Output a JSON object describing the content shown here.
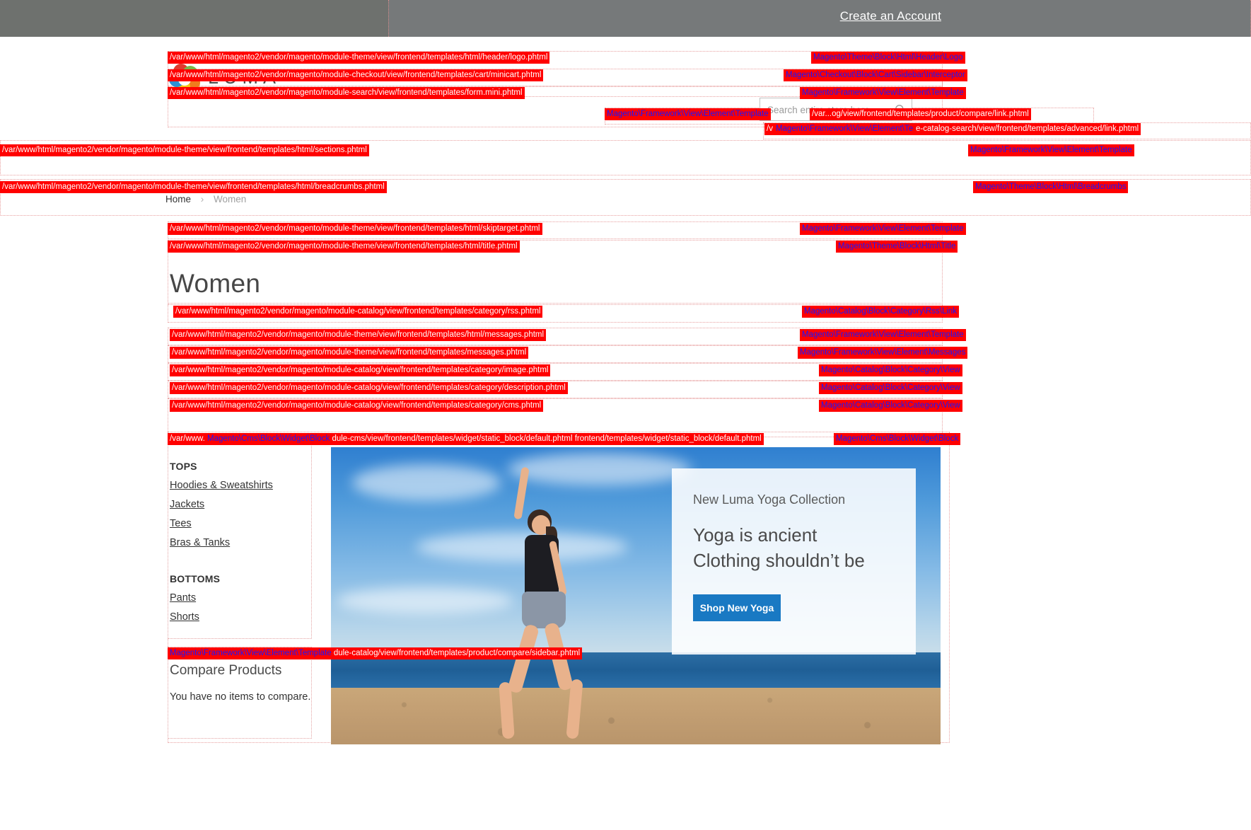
{
  "top_panel": {
    "create_account": "Create an Account"
  },
  "header": {
    "logo_text": "LUMA",
    "logo_alt": "luma-logo-icon"
  },
  "search": {
    "placeholder": "Search entire store here...",
    "value": ""
  },
  "breadcrumbs": {
    "home": "Home",
    "separator": "›",
    "current": "Women"
  },
  "page": {
    "title": "Women"
  },
  "sidebar": {
    "groups": [
      {
        "heading": "TOPS",
        "items": [
          "Hoodies & Sweatshirts",
          "Jackets",
          "Tees",
          "Bras & Tanks"
        ]
      },
      {
        "heading": "BOTTOMS",
        "items": [
          "Pants",
          "Shorts"
        ]
      }
    ]
  },
  "compare": {
    "title": "Compare Products",
    "empty_message": "You have no items to compare."
  },
  "promo": {
    "eyebrow": "New Luma Yoga Collection",
    "headline_line1": "Yoga is ancient",
    "headline_line2": "Clothing shouldn’t be",
    "button": "Shop New Yoga"
  },
  "colors": {
    "hint_background": "#ff0000",
    "hint_path_text": "#ffffff",
    "hint_class_text": "#1717ff",
    "top_panel": "#76797a",
    "button_primary": "#1979c3"
  },
  "hints": [
    {
      "id": "header-logo-path",
      "kind": "path",
      "text": "/var/www/html/magento2/vendor/magento/module-theme/view/frontend/templates/html/header/logo.phtml"
    },
    {
      "id": "header-logo-class",
      "kind": "class",
      "text": "Magento\\Theme\\Block\\Html\\Header\\Logo"
    },
    {
      "id": "minicart-path",
      "kind": "path",
      "text": "/var/www/html/magento2/vendor/magento/module-checkout/view/frontend/templates/cart/minicart.phtml"
    },
    {
      "id": "minicart-class",
      "kind": "class",
      "text": "Magento\\Checkout\\Block\\Cart\\Sidebar\\Interceptor"
    },
    {
      "id": "search-form-path",
      "kind": "path",
      "text": "/var/www/html/magento2/vendor/magento/module-search/view/frontend/templates/form.mini.phtml"
    },
    {
      "id": "search-form-class",
      "kind": "class",
      "text": "Magento\\Framework\\View\\Element\\Template"
    },
    {
      "id": "compare-link-class",
      "kind": "class",
      "text": "Magento\\Framework\\View\\Element\\Template"
    },
    {
      "id": "compare-link-path",
      "kind": "path",
      "text": "/var...og/view/frontend/templates/product/compare/link.phtml"
    },
    {
      "id": "advanced-link-prefix",
      "kind": "path",
      "text": "/v"
    },
    {
      "id": "advanced-link-class",
      "kind": "class",
      "text": "Magento\\Framework\\View\\Element\\Template"
    },
    {
      "id": "advanced-link-path",
      "kind": "path",
      "text": "e-catalog-search/view/frontend/templates/advanced/link.phtml"
    },
    {
      "id": "sections-path",
      "kind": "path",
      "text": "/var/www/html/magento2/vendor/magento/module-theme/view/frontend/templates/html/sections.phtml"
    },
    {
      "id": "sections-class",
      "kind": "class",
      "text": "Magento\\Framework\\View\\Element\\Template"
    },
    {
      "id": "breadcrumbs-path",
      "kind": "path",
      "text": "/var/www/html/magento2/vendor/magento/module-theme/view/frontend/templates/html/breadcrumbs.phtml"
    },
    {
      "id": "breadcrumbs-class",
      "kind": "class",
      "text": "Magento\\Theme\\Block\\Html\\Breadcrumbs"
    },
    {
      "id": "skiptarget-path",
      "kind": "path",
      "text": "/var/www/html/magento2/vendor/magento/module-theme/view/frontend/templates/html/skiptarget.phtml"
    },
    {
      "id": "skiptarget-class",
      "kind": "class",
      "text": "Magento\\Framework\\View\\Element\\Template"
    },
    {
      "id": "title-path",
      "kind": "path",
      "text": "/var/www/html/magento2/vendor/magento/module-theme/view/frontend/templates/html/title.phtml"
    },
    {
      "id": "title-class",
      "kind": "class",
      "text": "Magento\\Theme\\Block\\Html\\Title"
    },
    {
      "id": "rss-path",
      "kind": "path",
      "text": "/var/www/html/magento2/vendor/magento/module-catalog/view/frontend/templates/category/rss.phtml"
    },
    {
      "id": "rss-class",
      "kind": "class",
      "text": "Magento\\Catalog\\Block\\Category\\Rss\\Link"
    },
    {
      "id": "messages-html-path",
      "kind": "path",
      "text": "/var/www/html/magento2/vendor/magento/module-theme/view/frontend/templates/html/messages.phtml"
    },
    {
      "id": "messages-html-class",
      "kind": "class",
      "text": "Magento\\Framework\\View\\Element\\Template"
    },
    {
      "id": "messages-path",
      "kind": "path",
      "text": "/var/www/html/magento2/vendor/magento/module-theme/view/frontend/templates/messages.phtml"
    },
    {
      "id": "messages-class",
      "kind": "class",
      "text": "Magento\\Framework\\View\\Element\\Messages"
    },
    {
      "id": "cat-image-path",
      "kind": "path",
      "text": "/var/www/html/magento2/vendor/magento/module-catalog/view/frontend/templates/category/image.phtml"
    },
    {
      "id": "cat-image-class",
      "kind": "class",
      "text": "Magento\\Catalog\\Block\\Category\\View"
    },
    {
      "id": "cat-desc-path",
      "kind": "path",
      "text": "/var/www/html/magento2/vendor/magento/module-catalog/view/frontend/templates/category/description.phtml"
    },
    {
      "id": "cat-desc-class",
      "kind": "class",
      "text": "Magento\\Catalog\\Block\\Category\\View"
    },
    {
      "id": "cat-cms-path",
      "kind": "path",
      "text": "/var/www/html/magento2/vendor/magento/module-catalog/view/frontend/templates/category/cms.phtml"
    },
    {
      "id": "cat-cms-class",
      "kind": "class",
      "text": "Magento\\Catalog\\Block\\Category\\View"
    },
    {
      "id": "widget-prefix",
      "kind": "path",
      "text": "/var/www."
    },
    {
      "id": "widget-class-inline",
      "kind": "class",
      "text": "Magento\\Cms\\Block\\Widget\\Block"
    },
    {
      "id": "widget-path-a",
      "kind": "path",
      "text": "dule-cms/view/frontend/templates/widget/static_block/default.phtml"
    },
    {
      "id": "widget-path-b",
      "kind": "path",
      "text": "frontend/templates/widget/static_block/default.phtml"
    },
    {
      "id": "widget-class-right",
      "kind": "class",
      "text": "Magento\\Cms\\Block\\Widget\\Block"
    },
    {
      "id": "compare-sidebar-class",
      "kind": "class",
      "text": "Magento\\Framework\\View\\Element\\Template"
    },
    {
      "id": "compare-sidebar-path",
      "kind": "path",
      "text": "dule-catalog/view/frontend/templates/product/compare/sidebar.phtml"
    }
  ]
}
